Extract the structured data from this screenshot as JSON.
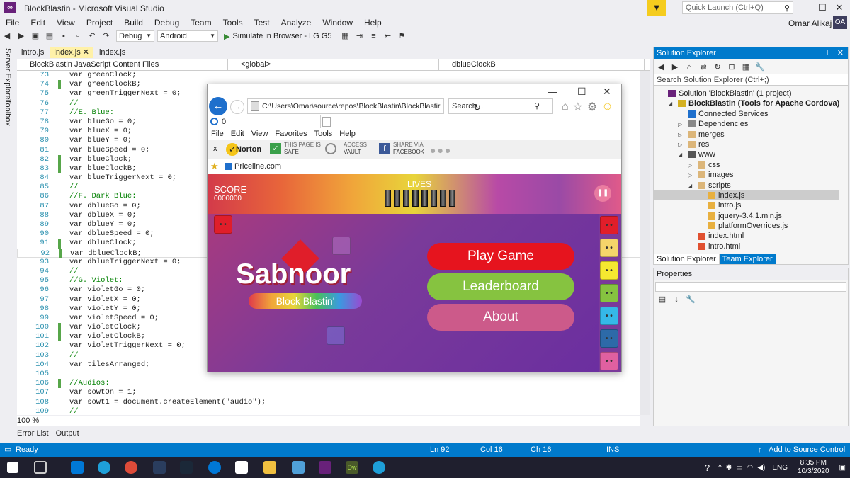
{
  "window": {
    "title": "BlockBlastin - Microsoft Visual Studio",
    "quick_launch_placeholder": "Quick Launch (Ctrl+Q)",
    "user": "Omar Alikaj",
    "avatar": "OA"
  },
  "menu": [
    "File",
    "Edit",
    "View",
    "Project",
    "Build",
    "Debug",
    "Team",
    "Tools",
    "Test",
    "Analyze",
    "Window",
    "Help"
  ],
  "toolbar": {
    "config": "Debug",
    "platform": "Android",
    "run_label": "Simulate in Browser - LG G5"
  },
  "left_strip": [
    "Server Explorer",
    "Toolbox"
  ],
  "editor_tabs": [
    {
      "label": "intro.js",
      "active": false
    },
    {
      "label": "index.js",
      "active": true,
      "close": "✕"
    },
    {
      "label": "index.js",
      "active": false
    }
  ],
  "nav": {
    "project": "BlockBlastin JavaScript Content Files",
    "scope": "<global>",
    "member": "dblueClockB"
  },
  "code": [
    {
      "n": "73",
      "t": "var greenClock;",
      "g": "none"
    },
    {
      "n": "74",
      "t": "var greenClockB;",
      "g": "green"
    },
    {
      "n": "75",
      "t": "var greenTriggerNext = 0;",
      "g": "none"
    },
    {
      "n": "76",
      "t": "//",
      "g": "none"
    },
    {
      "n": "77",
      "t": "//E. Blue:",
      "g": "none"
    },
    {
      "n": "78",
      "t": "var blueGo = 0;",
      "g": "none"
    },
    {
      "n": "79",
      "t": "var blueX = 0;",
      "g": "none"
    },
    {
      "n": "80",
      "t": "var blueY = 0;",
      "g": "none"
    },
    {
      "n": "81",
      "t": "var blueSpeed = 0;",
      "g": "none"
    },
    {
      "n": "82",
      "t": "var blueClock;",
      "g": "green"
    },
    {
      "n": "83",
      "t": "var blueClockB;",
      "g": "green"
    },
    {
      "n": "84",
      "t": "var blueTriggerNext = 0;",
      "g": "none"
    },
    {
      "n": "85",
      "t": "//",
      "g": "none"
    },
    {
      "n": "86",
      "t": "//F. Dark Blue:",
      "g": "none"
    },
    {
      "n": "87",
      "t": "var dblueGo = 0;",
      "g": "none"
    },
    {
      "n": "88",
      "t": "var dblueX = 0;",
      "g": "none"
    },
    {
      "n": "89",
      "t": "var dblueY = 0;",
      "g": "none"
    },
    {
      "n": "90",
      "t": "var dblueSpeed = 0;",
      "g": "none"
    },
    {
      "n": "91",
      "t": "var dblueClock;",
      "g": "green"
    },
    {
      "n": "92",
      "t": "var dblueClockB;",
      "g": "green"
    },
    {
      "n": "93",
      "t": "var dblueTriggerNext = 0;",
      "g": "none"
    },
    {
      "n": "94",
      "t": "//",
      "g": "none"
    },
    {
      "n": "95",
      "t": "//G. Violet:",
      "g": "none"
    },
    {
      "n": "96",
      "t": "var violetGo = 0;",
      "g": "none"
    },
    {
      "n": "97",
      "t": "var violetX = 0;",
      "g": "none"
    },
    {
      "n": "98",
      "t": "var violetY = 0;",
      "g": "none"
    },
    {
      "n": "99",
      "t": "var violetSpeed = 0;",
      "g": "none"
    },
    {
      "n": "100",
      "t": "var violetClock;",
      "g": "green"
    },
    {
      "n": "101",
      "t": "var violetClockB;",
      "g": "green"
    },
    {
      "n": "102",
      "t": "var violetTriggerNext = 0;",
      "g": "none"
    },
    {
      "n": "103",
      "t": "//",
      "g": "none"
    },
    {
      "n": "104",
      "t": "var tilesArranged;",
      "g": "none"
    },
    {
      "n": "105",
      "t": "",
      "g": "none"
    },
    {
      "n": "106",
      "t": "//Audios:",
      "g": "green"
    },
    {
      "n": "107",
      "t": "var sowtOn = 1;",
      "g": "none"
    },
    {
      "n": "108",
      "t": "var sowt1 = document.createElement(\"audio\");",
      "g": "none"
    },
    {
      "n": "109",
      "t": "//",
      "g": "none"
    }
  ],
  "zoom": "100 %",
  "bottom_tabs": [
    "Error List",
    "Output"
  ],
  "browser": {
    "address": "C:\\Users\\Omar\\source\\repos\\BlockBlastin\\BlockBlastir",
    "search_placeholder": "Search...",
    "tab_title": "0",
    "menu": [
      "File",
      "Edit",
      "View",
      "Favorites",
      "Tools",
      "Help"
    ],
    "norton": {
      "close": "x",
      "brand": "Norton",
      "safe_top": "THIS PAGE IS",
      "safe_bottom": "SAFE",
      "vault_top": "ACCESS",
      "vault_bottom": "VAULT",
      "share_top": "SHARE VIA",
      "share_bottom": "FACEBOOK"
    },
    "favorite": "Priceline.com"
  },
  "game": {
    "score_label": "SCORE",
    "score_value": "0000000",
    "lives_label": "LIVES",
    "lives_count": 8,
    "logo": "Sabnoor",
    "subtitle": "Block Blastin'",
    "buttons": {
      "play": "Play Game",
      "leaderboard": "Leaderboard",
      "about": "About"
    },
    "side_tiles": [
      "#e01e2a",
      "#f5d56a",
      "#f5e830",
      "#86c340",
      "#35b8e8",
      "#2d6aa8",
      "#e060a0"
    ],
    "colors": {
      "play": "#e6141e",
      "leaderboard": "#86c340",
      "about": "#cc5a8a"
    }
  },
  "solution_explorer": {
    "title": "Solution Explorer",
    "search_placeholder": "Search Solution Explorer (Ctrl+;)",
    "tree": [
      {
        "label": "Solution 'BlockBlastin' (1 project)",
        "indent": 0,
        "exp": "",
        "icon": "solution-icon",
        "bold": false
      },
      {
        "label": "BlockBlastin (Tools for Apache Cordova)",
        "indent": 1,
        "exp": "◢",
        "icon": "js-project-icon",
        "bold": true
      },
      {
        "label": "Connected Services",
        "indent": 2,
        "exp": "",
        "icon": "services-icon",
        "bold": false
      },
      {
        "label": "Dependencies",
        "indent": 2,
        "exp": "▷",
        "icon": "deps-icon",
        "bold": false
      },
      {
        "label": "merges",
        "indent": 2,
        "exp": "▷",
        "icon": "folder-icon",
        "bold": false
      },
      {
        "label": "res",
        "indent": 2,
        "exp": "▷",
        "icon": "folder-icon",
        "bold": false
      },
      {
        "label": "www",
        "indent": 2,
        "exp": "◢",
        "icon": "globe-icon",
        "bold": false
      },
      {
        "label": "css",
        "indent": 3,
        "exp": "▷",
        "icon": "folder-icon",
        "bold": false
      },
      {
        "label": "images",
        "indent": 3,
        "exp": "▷",
        "icon": "folder-icon",
        "bold": false
      },
      {
        "label": "scripts",
        "indent": 3,
        "exp": "◢",
        "icon": "folder-open-icon",
        "bold": false
      },
      {
        "label": "index.js",
        "indent": 4,
        "exp": "",
        "icon": "js-file-icon",
        "bold": false,
        "selected": true
      },
      {
        "label": "intro.js",
        "indent": 4,
        "exp": "",
        "icon": "js-file-icon",
        "bold": false
      },
      {
        "label": "jquery-3.4.1.min.js",
        "indent": 4,
        "exp": "",
        "icon": "js-file-icon",
        "bold": false
      },
      {
        "label": "platformOverrides.js",
        "indent": 4,
        "exp": "",
        "icon": "js-file-icon",
        "bold": false
      },
      {
        "label": "index.html",
        "indent": 3,
        "exp": "",
        "icon": "html-file-icon",
        "bold": false
      },
      {
        "label": "intro.html",
        "indent": 3,
        "exp": "",
        "icon": "html-file-icon",
        "bold": false
      }
    ],
    "tabs": [
      "Solution Explorer",
      "Team Explorer"
    ]
  },
  "properties": {
    "title": "Properties"
  },
  "status": {
    "ready": "Ready",
    "ln": "Ln 92",
    "col": "Col 16",
    "ch": "Ch 16",
    "mode": "INS",
    "source": "Add to Source Control"
  },
  "taskbar": {
    "lang": "ENG",
    "time": "8:35 PM",
    "date": "10/3/2020"
  }
}
